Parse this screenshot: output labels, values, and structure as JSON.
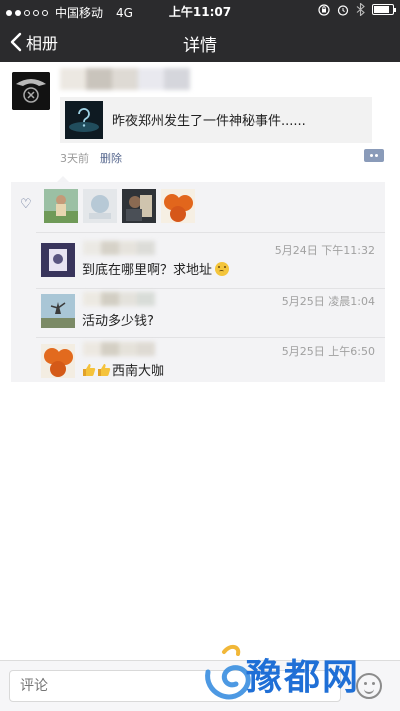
{
  "status_bar": {
    "carrier": "中国移动",
    "network": "4G",
    "time": "上午11:07",
    "battery_level": 0.85
  },
  "nav": {
    "back_label": "相册",
    "title": "详情"
  },
  "post": {
    "link_title": "昨夜郑州发生了一件神秘事件......",
    "time": "3天前",
    "delete_label": "删除"
  },
  "comments": [
    {
      "time": "5月24日 下午11:32",
      "text": "到底在哪里啊？求地址"
    },
    {
      "time": "5月25日 凌晨1:04",
      "text": "活动多少钱?"
    },
    {
      "time": "5月25日 上午6:50",
      "text": "西南大咖"
    }
  ],
  "bottom_bar": {
    "placeholder": "评论"
  },
  "watermark": "豫都网",
  "colors": {
    "bar_background": "#2b2b2d",
    "link_blue": "#56678e",
    "panel_background": "#f3f3f5",
    "watermark_blue": "#1f6fd6"
  }
}
